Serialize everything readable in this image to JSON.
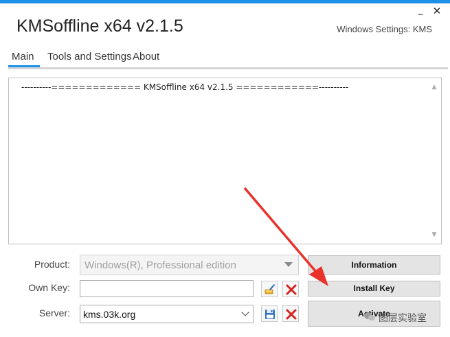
{
  "window": {
    "title": "KMSoffline x64 v2.1.5",
    "settings_label": "Windows Settings: KMS",
    "minimize_glyph": "_",
    "close_glyph": "✕"
  },
  "tabs": [
    {
      "label": "Main",
      "active": true
    },
    {
      "label": "Tools and Settings",
      "active": false
    },
    {
      "label": "About",
      "active": false
    }
  ],
  "log": {
    "text": "----------============= KMSoffline x64 v2.1.5 ============----------"
  },
  "form": {
    "product_label": "Product:",
    "product_value": "Windows(R), Professional edition",
    "ownkey_label": "Own Key:",
    "ownkey_value": "",
    "server_label": "Server:",
    "server_value": "kms.03k.org"
  },
  "buttons": {
    "information": "Information",
    "install_key": "Install Key",
    "activate": "Activate"
  },
  "watermark": {
    "text": "图层实验室"
  },
  "colors": {
    "accent": "#1e90e8",
    "annotation_arrow": "#e8322a"
  },
  "icons": {
    "brush": "brush-icon",
    "clear": "clear-x-icon",
    "save": "floppy-save-icon"
  }
}
